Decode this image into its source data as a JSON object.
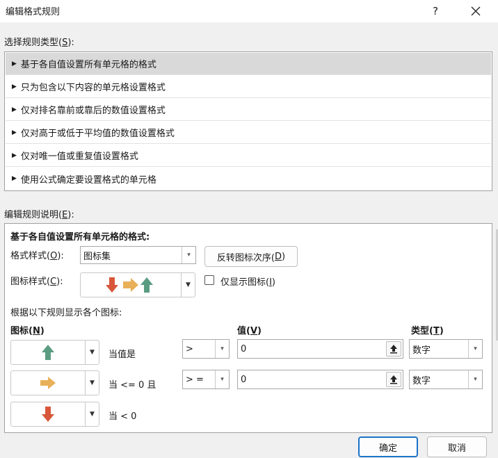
{
  "window": {
    "title": "编辑格式规则",
    "help": "?",
    "close": "✕"
  },
  "rule_type": {
    "label": "选择规则类型(",
    "accel": "S",
    "label_tail": "):",
    "items": [
      {
        "label": "基于各自值设置所有单元格的格式",
        "selected": true
      },
      {
        "label": "只为包含以下内容的单元格设置格式"
      },
      {
        "label": "仅对排名靠前或靠后的数值设置格式"
      },
      {
        "label": "仅对高于或低于平均值的数值设置格式"
      },
      {
        "label": "仅对唯一值或重复值设置格式"
      },
      {
        "label": "使用公式确定要设置格式的单元格"
      }
    ]
  },
  "description": {
    "label": "编辑规则说明(",
    "accel": "E",
    "label_tail": "):",
    "heading": "基于各自值设置所有单元格的格式:",
    "format_style": {
      "label": "格式样式(",
      "accel": "O",
      "tail": "):",
      "value": "图标集"
    },
    "reverse_button": {
      "label": "反转图标次序(",
      "accel": "D",
      "tail": ")"
    },
    "icon_style": {
      "label": "图标样式(",
      "accel": "C",
      "tail": "):"
    },
    "show_icon_only": {
      "label": "仅显示图标(",
      "accel": "I",
      "tail": ")",
      "checked": false
    },
    "rules_caption": "根据以下规则显示各个图标:",
    "col_icon": {
      "label": "图标(",
      "accel": "N",
      "tail": ")"
    },
    "col_value": {
      "label": "值(",
      "accel": "V",
      "tail": ")"
    },
    "col_type": {
      "label": "类型(",
      "accel": "T",
      "tail": ")"
    },
    "rows": [
      {
        "icon": "green-up-arrow-icon",
        "condition": "当值是",
        "operator": ">",
        "value": "0",
        "type": "数字"
      },
      {
        "icon": "yellow-right-arrow-icon",
        "condition": "当 <= 0 且",
        "operator": "> =",
        "value": "0",
        "type": "数字"
      },
      {
        "icon": "red-down-arrow-icon",
        "condition": "当 < 0"
      }
    ]
  },
  "buttons": {
    "ok": "确定",
    "cancel": "取消"
  },
  "colors": {
    "up": "#5a9c82",
    "side": "#e8b058",
    "down": "#d8573a",
    "accent": "#1a73c8"
  }
}
